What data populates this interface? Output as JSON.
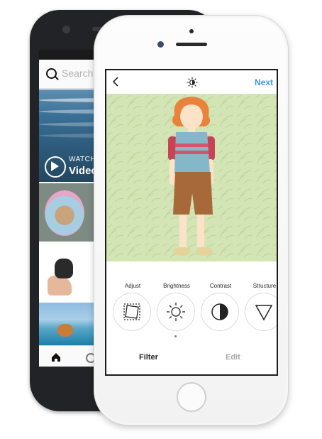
{
  "back_phone": {
    "search": {
      "placeholder": "Search"
    },
    "video_tile": {
      "watch_label": "WATCH",
      "video_label": "Video"
    }
  },
  "editor": {
    "header": {
      "next_label": "Next",
      "back_icon": "chevron-left-icon",
      "lux_icon": "lux-sun-icon"
    },
    "tools": [
      {
        "label": "Adjust",
        "icon": "adjust-crop-icon"
      },
      {
        "label": "Brightness",
        "icon": "sun-icon"
      },
      {
        "label": "Contrast",
        "icon": "contrast-icon"
      },
      {
        "label": "Structure",
        "icon": "triangle-icon"
      }
    ],
    "tabs": {
      "filter": "Filter",
      "edit": "Edit"
    }
  },
  "colors": {
    "accent": "#3897f0",
    "photo_bg": "#d3e4b5"
  }
}
